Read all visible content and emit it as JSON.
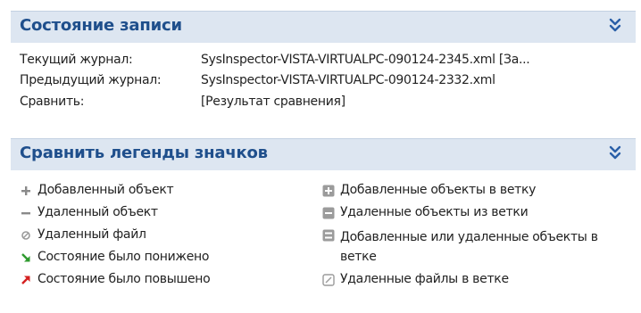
{
  "record_state": {
    "title": "Состояние записи",
    "current_log_label": "Текущий журнал:",
    "current_log_value": "SysInspector-VISTA-VIRTUALPC-090124-2345.xml [За...",
    "previous_log_label": "Предыдущий журнал:",
    "previous_log_value": "SysInspector-VISTA-VIRTUALPC-090124-2332.xml",
    "compare_label": "Сравнить:",
    "compare_value": "[Результат сравнения]"
  },
  "legend": {
    "title": "Сравнить легенды значков",
    "left_items": [
      {
        "icon": "plus-icon",
        "label": "Добавленный объект"
      },
      {
        "icon": "minus-icon",
        "label": "Удаленный объект"
      },
      {
        "icon": "deleted-file-icon",
        "label": "Удаленный файл"
      },
      {
        "icon": "arrow-down-green-icon",
        "label": "Состояние было понижено"
      },
      {
        "icon": "arrow-up-red-icon",
        "label": "Состояние было повышено"
      }
    ],
    "right_items": [
      {
        "icon": "box-plus-icon",
        "label": "Добавленные объекты в ветку"
      },
      {
        "icon": "box-minus-icon",
        "label": "Удаленные объекты из ветки"
      },
      {
        "icon": "box-plusminus-icon",
        "label": "Добавленные или удаленные объекты в ветке"
      },
      {
        "icon": "box-deleted-file-icon",
        "label": "Удаленные файлы в ветке"
      }
    ]
  },
  "colors": {
    "header_bg": "#dde6f1",
    "header_text": "#1f4f8c",
    "chevron": "#2a5fa8",
    "arrow_down": "#2e9a2e",
    "arrow_up": "#d42020",
    "icon_gray": "#8a8a8a"
  }
}
